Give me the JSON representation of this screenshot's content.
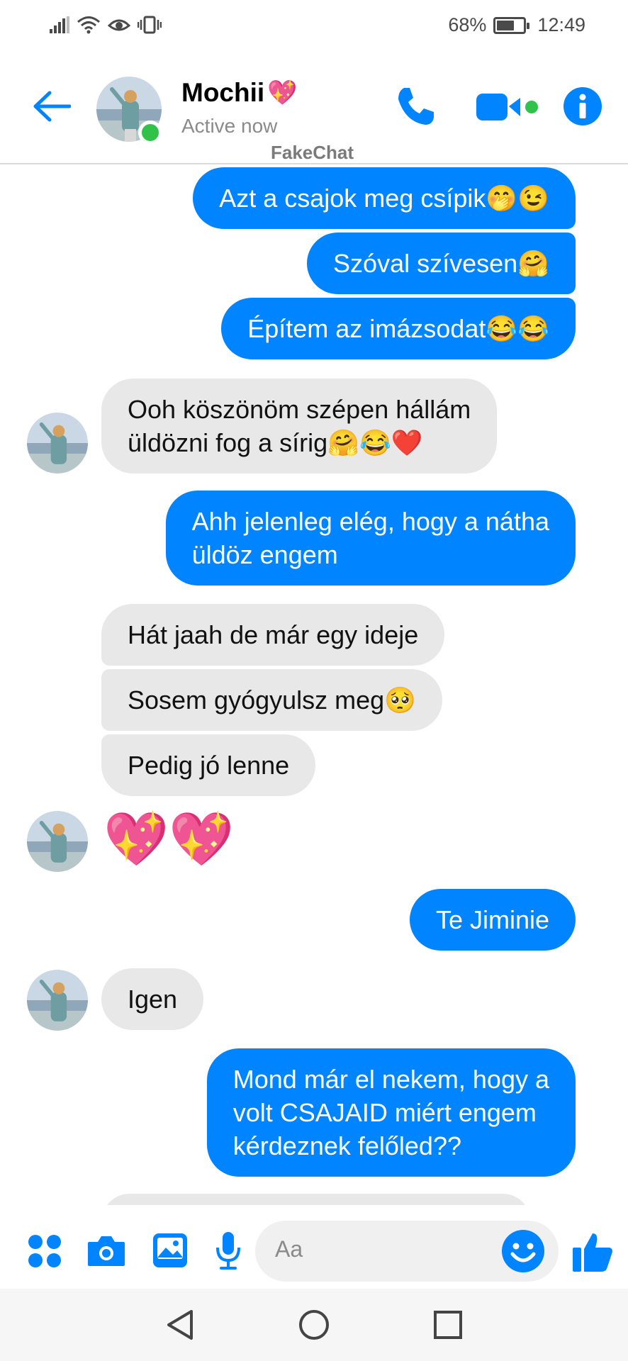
{
  "status_bar": {
    "battery_percent_text": "68%",
    "battery_level": 0.68,
    "time": "12:49"
  },
  "header": {
    "contact_name": "Mochii",
    "contact_status": "Active now",
    "watermark": "FakeChat",
    "accent_color": "#0084ff",
    "online_color": "#31c24a"
  },
  "messages": [
    {
      "id": "m1",
      "direction": "sent",
      "text": "Azt a csajok meg csípik🤭😉"
    },
    {
      "id": "m2",
      "direction": "sent",
      "text": "Szóval szívesen🤗"
    },
    {
      "id": "m3",
      "direction": "sent",
      "text": "Építem az imázsodat😂😂"
    },
    {
      "id": "m4",
      "direction": "received",
      "lines": [
        "Ooh köszönöm szépen hállám",
        "üldözni fog a sírig🤗😂❤️"
      ]
    },
    {
      "id": "m5",
      "direction": "sent",
      "lines": [
        "Ahh jelenleg elég, hogy a nátha",
        "üldöz engem"
      ]
    },
    {
      "id": "m6",
      "direction": "received",
      "text": "Hát jaah de már egy ideje"
    },
    {
      "id": "m7",
      "direction": "received",
      "text": "Sosem gyógyulsz meg🥺"
    },
    {
      "id": "m8",
      "direction": "received",
      "text": "Pedig jó lenne"
    },
    {
      "id": "m9",
      "direction": "received",
      "text": "💖💖"
    },
    {
      "id": "m10",
      "direction": "sent",
      "text": "Te Jiminie"
    },
    {
      "id": "m11",
      "direction": "received",
      "text": "Igen"
    },
    {
      "id": "m12",
      "direction": "sent",
      "lines": [
        "Mond már el nekem, hogy a",
        "volt CSAJAID miért engem",
        "kérdeznek felőled??"
      ]
    }
  ],
  "composer": {
    "placeholder": "Aa",
    "icons": [
      "menu-dots-icon",
      "camera-icon",
      "gallery-icon",
      "microphone-icon",
      "emoji-icon",
      "thumbs-up-icon"
    ]
  },
  "navbar": {
    "icons": [
      "back-triangle-icon",
      "home-circle-icon",
      "recents-square-icon"
    ]
  }
}
